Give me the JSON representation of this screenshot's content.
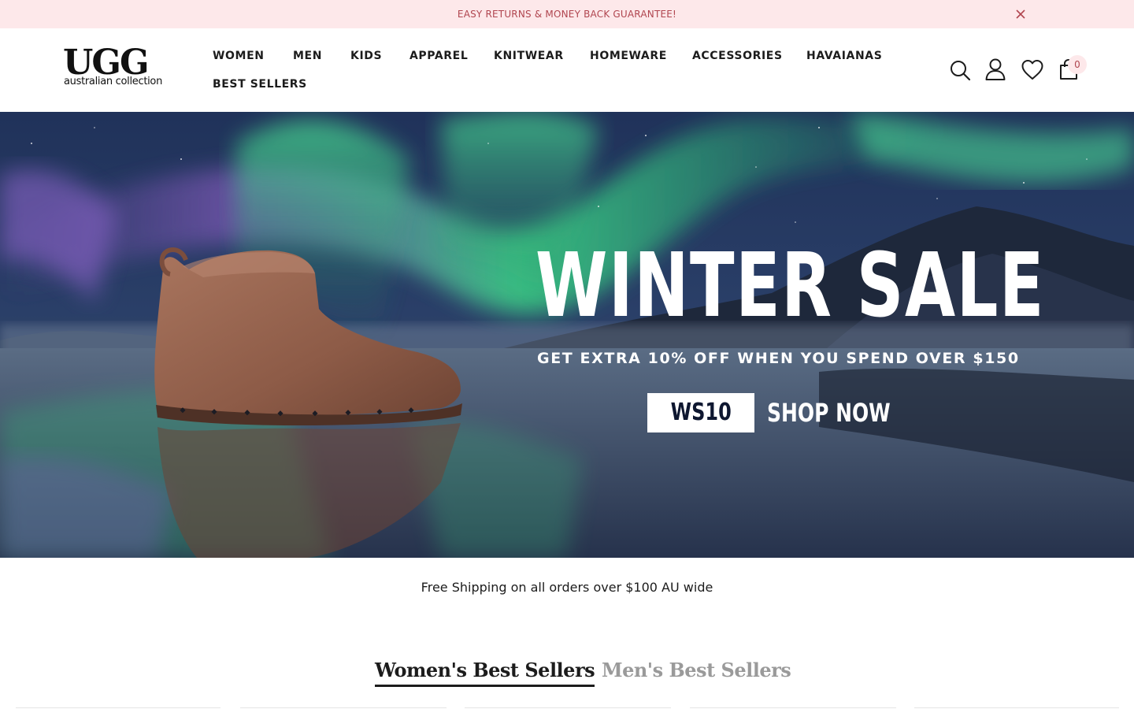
{
  "announcement": {
    "text": "EASY RETURNS & MONEY BACK GUARANTEE!"
  },
  "brand": {
    "logo_main": "UGG",
    "logo_sub": "australian collection"
  },
  "nav": {
    "items": [
      "WOMEN",
      "MEN",
      "KIDS",
      "APPAREL",
      "KNITWEAR",
      "HOMEWARE",
      "ACCESSORIES",
      "HAVAIANAS",
      "BEST SELLERS"
    ]
  },
  "header_icons": {
    "search": "search-icon",
    "account": "user-icon",
    "wishlist": "heart-icon",
    "cart": "shopping-bag-icon",
    "cart_count": "0"
  },
  "hero": {
    "title": "WINTER SALE",
    "subtitle": "GET EXTRA 10% OFF WHEN YOU SPEND OVER $150",
    "code": "WS10",
    "cta": "SHOP NOW"
  },
  "shipping_notice": "Free Shipping on all orders over $100 AU wide",
  "tabs": [
    {
      "label": "Women's Best Sellers",
      "active": true
    },
    {
      "label": "Men's Best Sellers",
      "active": false
    }
  ],
  "colors": {
    "announcement_bg": "#fde8ea",
    "announcement_text": "#b0454f",
    "text": "#1c1c1c",
    "muted": "#9a9a9a"
  }
}
